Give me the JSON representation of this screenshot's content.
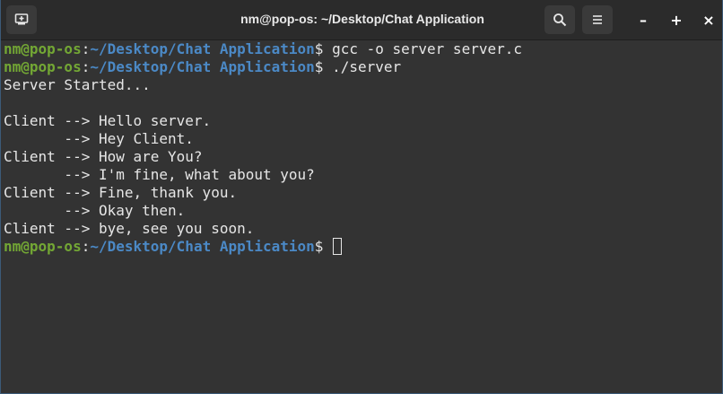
{
  "window": {
    "title": "nm@pop-os: ~/Desktop/Chat Application",
    "minimize_label": "–",
    "maximize_label": "+",
    "close_label": "×",
    "new_tab_icon": "new-tab-icon",
    "search_icon": "search-icon",
    "menu_icon": "hamburger-menu-icon"
  },
  "colors": {
    "background": "#333333",
    "titlebar": "#2b2b2b",
    "prompt_user": "#73a734",
    "prompt_path": "#4b89c6",
    "text": "#e6e6e6"
  },
  "terminal": {
    "prompt_user": "nm@pop-os",
    "prompt_colon": ":",
    "prompt_path": "~/Desktop/Chat Application",
    "prompt_dollar": "$",
    "commands": [
      " gcc -o server server.c",
      " ./server"
    ],
    "output": [
      "Server Started...",
      "",
      "Client --> Hello server.",
      "       --> Hey Client.",
      "Client --> How are You?",
      "       --> I'm fine, what about you?",
      "Client --> Fine, thank you.",
      "       --> Okay then.",
      "Client --> bye, see you soon."
    ],
    "final_prompt_trailing": " "
  }
}
